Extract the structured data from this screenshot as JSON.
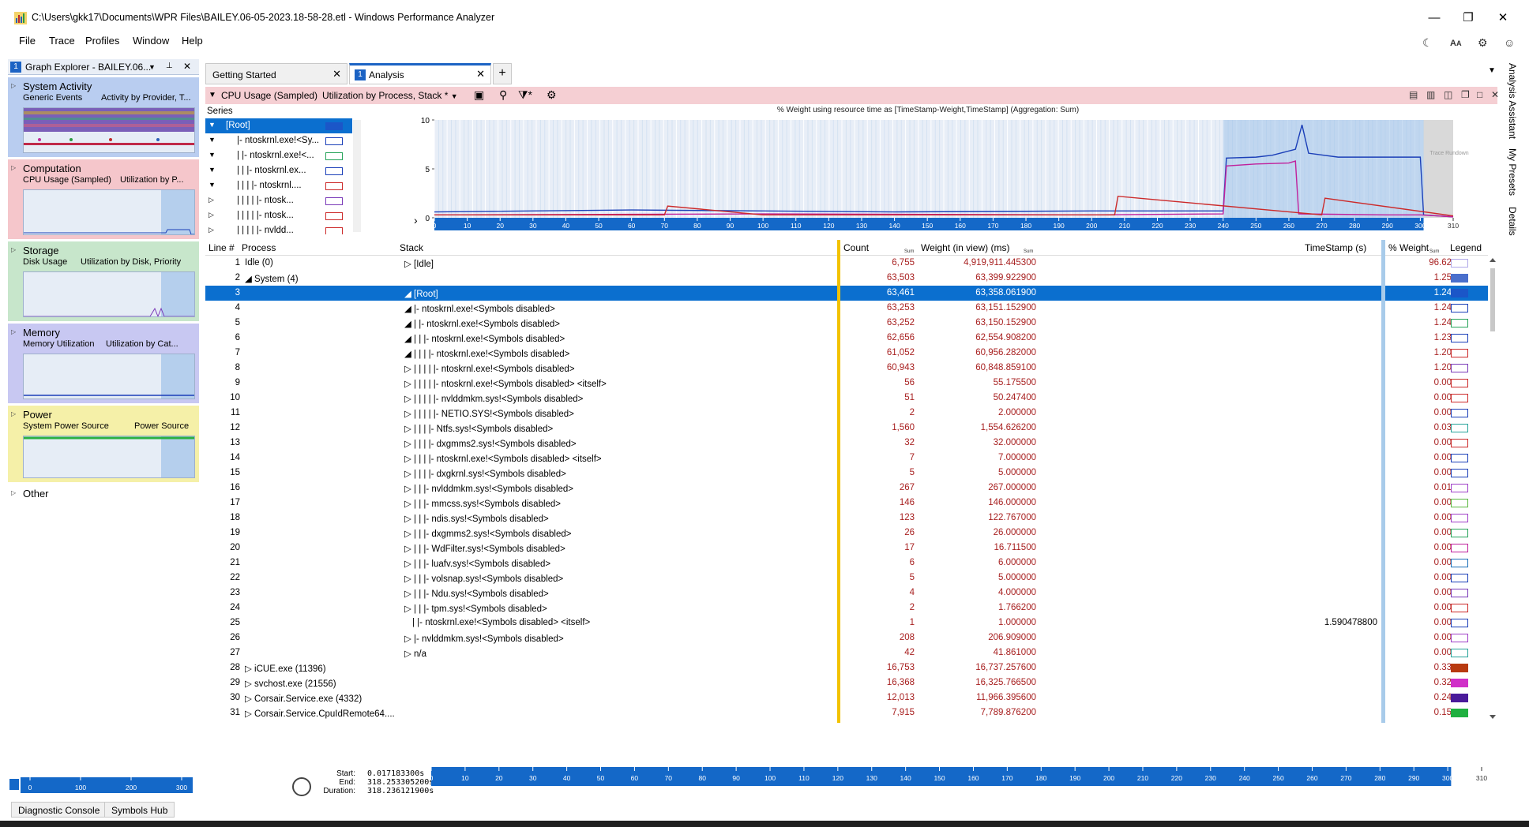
{
  "window": {
    "title": "C:\\Users\\gkk17\\Documents\\WPR Files\\BAILEY.06-05-2023.18-58-28.etl - Windows Performance Analyzer",
    "minimize": "—",
    "restore": "❐",
    "close": "✕"
  },
  "menu": [
    "File",
    "Trace",
    "Profiles",
    "Window",
    "Help"
  ],
  "toolbar_icons": [
    "moon-icon",
    "font-size-icon",
    "settings-gear-icon",
    "feedback-icon"
  ],
  "graph_explorer": {
    "badge": "1",
    "title": "Graph Explorer - BAILEY.06...",
    "pin": "📌",
    "close": "✕",
    "categories": [
      {
        "name": "System Activity",
        "sub1": "Generic Events",
        "sub2": "Activity by Provider, T...",
        "color": "#b9cdf0"
      },
      {
        "name": "Computation",
        "sub1": "CPU Usage (Sampled)",
        "sub2": "Utilization by P...",
        "color": "#f5c6cb"
      },
      {
        "name": "Storage",
        "sub1": "Disk Usage",
        "sub2": "Utilization by Disk, Priority",
        "color": "#c7e6cb"
      },
      {
        "name": "Memory",
        "sub1": "Memory Utilization",
        "sub2": "Utilization by Cat...",
        "color": "#c8c8f2"
      },
      {
        "name": "Power",
        "sub1": "System Power Source",
        "sub2": "Power Source",
        "color": "#f5f0a8"
      },
      {
        "name": "Other",
        "sub1": "",
        "sub2": "",
        "color": "#ffffff"
      }
    ]
  },
  "tabs": [
    {
      "label": "Getting Started",
      "close": "✕"
    },
    {
      "label": "Analysis",
      "badge": "1",
      "close": "✕"
    },
    {
      "label": "+"
    }
  ],
  "graph_header": {
    "title": "CPU Usage (Sampled)",
    "preset": "Utilization by Process, Stack *",
    "chart_caption": "% Weight using resource time as [TimeStamp-Weight,TimeStamp] (Aggregation: Sum)",
    "trace_runs_label": "Trace Rundown"
  },
  "series": {
    "label": "Series",
    "rows": [
      {
        "text": "[Root]",
        "indent": 26,
        "selected": true,
        "legend": "#1b56c8"
      },
      {
        "text": "|- ntoskrnl.exe!<Sy...",
        "indent": 40,
        "legend": "#1b3fb8"
      },
      {
        "text": "|  |- ntoskrnl.exe!<...",
        "indent": 40,
        "legend": "#27a35a"
      },
      {
        "text": "|  |  |- ntoskrnl.ex...",
        "indent": 40,
        "legend": "#1b3fb8"
      },
      {
        "text": "|  |  |  |- ntoskrnl....",
        "indent": 40,
        "legend": "#cc2a2a"
      },
      {
        "text": "|  |  |  |  |- ntosk...",
        "indent": 40,
        "legend": "#7a3ab8"
      },
      {
        "text": "|  |  |  |  |- ntosk...",
        "indent": 40,
        "legend": "#cc2a2a"
      },
      {
        "text": "|  |  |  |  |- nvldd...",
        "indent": 40,
        "legend": "#cc2a2a"
      }
    ]
  },
  "chart_data": {
    "type": "line",
    "title": "% Weight using resource time as [TimeStamp-Weight,TimeStamp] (Aggregation: Sum)",
    "xlabel": "",
    "ylabel": "",
    "ylim": [
      0,
      10
    ],
    "xlim": [
      0,
      310
    ],
    "yticks": [
      "10",
      "5",
      "0"
    ],
    "xticks": [
      "0",
      "10",
      "20",
      "30",
      "40",
      "50",
      "60",
      "70",
      "80",
      "90",
      "100",
      "110",
      "120",
      "130",
      "140",
      "150",
      "160",
      "170",
      "180",
      "190",
      "200",
      "210",
      "220",
      "230",
      "240",
      "250",
      "260",
      "270",
      "280",
      "290",
      "300",
      "310"
    ],
    "series": [
      {
        "color": "#1b3fb8",
        "x": [
          0,
          60,
          100,
          140,
          200,
          240,
          241,
          250,
          255,
          262,
          264,
          266,
          275,
          290,
          300,
          301,
          310
        ],
        "y": [
          0.6,
          0.8,
          0.7,
          0.6,
          0.7,
          0.7,
          6.1,
          6.2,
          6.4,
          7.0,
          9.5,
          6.6,
          6.2,
          6.2,
          6.2,
          0.3,
          0.1
        ]
      },
      {
        "color": "#c0209c",
        "x": [
          0,
          100,
          200,
          240,
          241,
          250,
          260,
          262,
          263,
          290,
          300,
          310
        ],
        "y": [
          0.3,
          0.4,
          0.3,
          0.4,
          5.3,
          5.5,
          5.6,
          5.8,
          0.4,
          0.3,
          0.3,
          0.1
        ]
      },
      {
        "color": "#cc2a2a",
        "x": [
          0,
          70,
          71,
          100,
          207,
          208,
          270,
          271,
          310
        ],
        "y": [
          0.3,
          0.3,
          1.2,
          0.3,
          0.3,
          2.2,
          0.3,
          2.0,
          0.2
        ]
      }
    ],
    "selection_range": [
      240,
      301
    ]
  },
  "table": {
    "headers": {
      "line": "Line #",
      "process": "Process",
      "stack": "Stack",
      "count": "Count",
      "weight": "Weight (in view) (ms)",
      "timestamp": "TimeStamp (s)",
      "pweight": "% Weight",
      "legend": "Legend",
      "sum": "Sum"
    },
    "rows": [
      {
        "line": "1",
        "proc": "Idle (0)",
        "proc_arrow": "",
        "stack": "[Idle]",
        "stack_arrow": "▷",
        "stack_indent": 6,
        "count": "6,755",
        "weight": "4,919,911.445300",
        "ts": "",
        "pw": "96.62",
        "legend": "#b0a8e8"
      },
      {
        "line": "2",
        "proc": "System (4)",
        "proc_arrow": "◢",
        "stack": "",
        "stack_arrow": "",
        "stack_indent": 6,
        "count": "63,503",
        "weight": "63,399.922900",
        "ts": "",
        "pw": "1.25",
        "legend": "#4a6fcc"
      },
      {
        "line": "3",
        "proc": "",
        "proc_arrow": "",
        "stack": "[Root]",
        "stack_arrow": "◢",
        "stack_indent": 6,
        "count": "63,461",
        "weight": "63,358.061900",
        "ts": "",
        "pw": "1.24",
        "legend": "#1b56c8",
        "selected": true
      },
      {
        "line": "4",
        "proc": "",
        "proc_arrow": "",
        "stack": "|- ntoskrnl.exe!<Symbols disabled>",
        "stack_arrow": "◢",
        "stack_indent": 6,
        "count": "63,253",
        "weight": "63,151.152900",
        "ts": "",
        "pw": "1.24",
        "legend": "#1b3fb8"
      },
      {
        "line": "5",
        "proc": "",
        "proc_arrow": "",
        "stack": "|   |- ntoskrnl.exe!<Symbols disabled>",
        "stack_arrow": "◢",
        "stack_indent": 6,
        "count": "63,252",
        "weight": "63,150.152900",
        "ts": "",
        "pw": "1.24",
        "legend": "#27a35a"
      },
      {
        "line": "6",
        "proc": "",
        "proc_arrow": "",
        "stack": "|   |   |- ntoskrnl.exe!<Symbols disabled>",
        "stack_arrow": "◢",
        "stack_indent": 6,
        "count": "62,656",
        "weight": "62,554.908200",
        "ts": "",
        "pw": "1.23",
        "legend": "#1b3fb8"
      },
      {
        "line": "7",
        "proc": "",
        "proc_arrow": "",
        "stack": "|   |   |   |- ntoskrnl.exe!<Symbols disabled>",
        "stack_arrow": "◢",
        "stack_indent": 6,
        "count": "61,052",
        "weight": "60,956.282000",
        "ts": "",
        "pw": "1.20",
        "legend": "#cc2a2a"
      },
      {
        "line": "8",
        "proc": "",
        "proc_arrow": "",
        "stack": "|   |   |   |   |- ntoskrnl.exe!<Symbols disabled>",
        "stack_arrow": "▷",
        "stack_indent": 6,
        "count": "60,943",
        "weight": "60,848.859100",
        "ts": "",
        "pw": "1.20",
        "legend": "#7a3ab8"
      },
      {
        "line": "9",
        "proc": "",
        "proc_arrow": "",
        "stack": "|   |   |   |   |- ntoskrnl.exe!<Symbols disabled> <itself>",
        "stack_arrow": "▷",
        "stack_indent": 6,
        "count": "56",
        "weight": "55.175500",
        "ts": "",
        "pw": "0.00",
        "legend": "#cc2a2a"
      },
      {
        "line": "10",
        "proc": "",
        "proc_arrow": "",
        "stack": "|   |   |   |   |- nvlddmkm.sys!<Symbols disabled>",
        "stack_arrow": "▷",
        "stack_indent": 6,
        "count": "51",
        "weight": "50.247400",
        "ts": "",
        "pw": "0.00",
        "legend": "#cc2a2a"
      },
      {
        "line": "11",
        "proc": "",
        "proc_arrow": "",
        "stack": "|   |   |   |   |- NETIO.SYS!<Symbols disabled>",
        "stack_arrow": "▷",
        "stack_indent": 6,
        "count": "2",
        "weight": "2.000000",
        "ts": "",
        "pw": "0.00",
        "legend": "#1b3fb8"
      },
      {
        "line": "12",
        "proc": "",
        "proc_arrow": "",
        "stack": "|   |   |   |- Ntfs.sys!<Symbols disabled>",
        "stack_arrow": "▷",
        "stack_indent": 6,
        "count": "1,560",
        "weight": "1,554.626200",
        "ts": "",
        "pw": "0.03",
        "legend": "#27a39a"
      },
      {
        "line": "13",
        "proc": "",
        "proc_arrow": "",
        "stack": "|   |   |   |- dxgmms2.sys!<Symbols disabled>",
        "stack_arrow": "▷",
        "stack_indent": 6,
        "count": "32",
        "weight": "32.000000",
        "ts": "",
        "pw": "0.00",
        "legend": "#cc2a2a"
      },
      {
        "line": "14",
        "proc": "",
        "proc_arrow": "",
        "stack": "|   |   |   |- ntoskrnl.exe!<Symbols disabled> <itself>",
        "stack_arrow": "▷",
        "stack_indent": 6,
        "count": "7",
        "weight": "7.000000",
        "ts": "",
        "pw": "0.00",
        "legend": "#1b3fb8"
      },
      {
        "line": "15",
        "proc": "",
        "proc_arrow": "",
        "stack": "|   |   |   |- dxgkrnl.sys!<Symbols disabled>",
        "stack_arrow": "▷",
        "stack_indent": 6,
        "count": "5",
        "weight": "5.000000",
        "ts": "",
        "pw": "0.00",
        "legend": "#1b3fb8"
      },
      {
        "line": "16",
        "proc": "",
        "proc_arrow": "",
        "stack": "|   |   |- nvlddmkm.sys!<Symbols disabled>",
        "stack_arrow": "▷",
        "stack_indent": 6,
        "count": "267",
        "weight": "267.000000",
        "ts": "",
        "pw": "0.01",
        "legend": "#a040c8"
      },
      {
        "line": "17",
        "proc": "",
        "proc_arrow": "",
        "stack": "|   |   |- mmcss.sys!<Symbols disabled>",
        "stack_arrow": "▷",
        "stack_indent": 6,
        "count": "146",
        "weight": "146.000000",
        "ts": "",
        "pw": "0.00",
        "legend": "#5ab840"
      },
      {
        "line": "18",
        "proc": "",
        "proc_arrow": "",
        "stack": "|   |   |- ndis.sys!<Symbols disabled>",
        "stack_arrow": "▷",
        "stack_indent": 6,
        "count": "123",
        "weight": "122.767000",
        "ts": "",
        "pw": "0.00",
        "legend": "#a040c8"
      },
      {
        "line": "19",
        "proc": "",
        "proc_arrow": "",
        "stack": "|   |   |- dxgmms2.sys!<Symbols disabled>",
        "stack_arrow": "▷",
        "stack_indent": 6,
        "count": "26",
        "weight": "26.000000",
        "ts": "",
        "pw": "0.00",
        "legend": "#27a35a"
      },
      {
        "line": "20",
        "proc": "",
        "proc_arrow": "",
        "stack": "|   |   |- WdFilter.sys!<Symbols disabled>",
        "stack_arrow": "▷",
        "stack_indent": 6,
        "count": "17",
        "weight": "16.711500",
        "ts": "",
        "pw": "0.00",
        "legend": "#c0209c"
      },
      {
        "line": "21",
        "proc": "",
        "proc_arrow": "",
        "stack": "|   |   |- luafv.sys!<Symbols disabled>",
        "stack_arrow": "▷",
        "stack_indent": 6,
        "count": "6",
        "weight": "6.000000",
        "ts": "",
        "pw": "0.00",
        "legend": "#1b6fb8"
      },
      {
        "line": "22",
        "proc": "",
        "proc_arrow": "",
        "stack": "|   |   |- volsnap.sys!<Symbols disabled>",
        "stack_arrow": "▷",
        "stack_indent": 6,
        "count": "5",
        "weight": "5.000000",
        "ts": "",
        "pw": "0.00",
        "legend": "#1b3fb8"
      },
      {
        "line": "23",
        "proc": "",
        "proc_arrow": "",
        "stack": "|   |   |- Ndu.sys!<Symbols disabled>",
        "stack_arrow": "▷",
        "stack_indent": 6,
        "count": "4",
        "weight": "4.000000",
        "ts": "",
        "pw": "0.00",
        "legend": "#7a3ab8"
      },
      {
        "line": "24",
        "proc": "",
        "proc_arrow": "",
        "stack": "|   |   |- tpm.sys!<Symbols disabled>",
        "stack_arrow": "▷",
        "stack_indent": 6,
        "count": "2",
        "weight": "1.766200",
        "ts": "",
        "pw": "0.00",
        "legend": "#cc2a2a"
      },
      {
        "line": "25",
        "proc": "",
        "proc_arrow": "",
        "stack": "|   |- ntoskrnl.exe!<Symbols disabled> <itself>",
        "stack_arrow": "",
        "stack_indent": 16,
        "count": "1",
        "weight": "1.000000",
        "ts": "1.590478800",
        "pw": "0.00",
        "legend": "#1b3fb8"
      },
      {
        "line": "26",
        "proc": "",
        "proc_arrow": "",
        "stack": "|- nvlddmkm.sys!<Symbols disabled>",
        "stack_arrow": "▷",
        "stack_indent": 6,
        "count": "208",
        "weight": "206.909000",
        "ts": "",
        "pw": "0.00",
        "legend": "#a040c8"
      },
      {
        "line": "27",
        "proc": "",
        "proc_arrow": "",
        "stack": "n/a",
        "stack_arrow": "▷",
        "stack_indent": 6,
        "count": "42",
        "weight": "41.861000",
        "ts": "",
        "pw": "0.00",
        "legend": "#27a39a"
      },
      {
        "line": "28",
        "proc": "iCUE.exe (11396)",
        "proc_arrow": "▷",
        "stack": "",
        "stack_arrow": "",
        "stack_indent": 6,
        "count": "16,753",
        "weight": "16,737.257600",
        "ts": "",
        "pw": "0.33",
        "legend": "#b83a10",
        "filled": true
      },
      {
        "line": "29",
        "proc": "svchost.exe (21556)",
        "proc_arrow": "▷",
        "stack": "",
        "stack_arrow": "",
        "stack_indent": 6,
        "count": "16,368",
        "weight": "16,325.766500",
        "ts": "",
        "pw": "0.32",
        "legend": "#d030c8",
        "filled": true
      },
      {
        "line": "30",
        "proc": "Corsair.Service.exe (4332)",
        "proc_arrow": "▷",
        "stack": "",
        "stack_arrow": "",
        "stack_indent": 6,
        "count": "12,013",
        "weight": "11,966.395600",
        "ts": "",
        "pw": "0.24",
        "legend": "#4a1a9a",
        "filled": true
      },
      {
        "line": "31",
        "proc": "Corsair.Service.CpuIdRemote64....",
        "proc_arrow": "▷",
        "stack": "",
        "stack_arrow": "",
        "stack_indent": 6,
        "count": "7,915",
        "weight": "7,789.876200",
        "ts": "",
        "pw": "0.15",
        "legend": "#20b040",
        "filled": true
      }
    ]
  },
  "timeline": {
    "start_label": "Start:",
    "end_label": "End:",
    "duration_label": "Duration:",
    "start": "0.017183300s",
    "end": "318.253305200s",
    "duration": "318.236121900s"
  },
  "mini_timeline": [
    "0",
    "100",
    "200",
    "300"
  ],
  "bottom_buttons": [
    "Diagnostic Console",
    "Symbols Hub"
  ],
  "side_rail": [
    "Analysis Assistant",
    "My Presets",
    "Details"
  ]
}
